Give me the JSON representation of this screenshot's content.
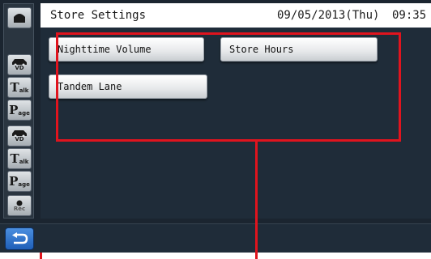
{
  "header": {
    "title": "Store Settings",
    "date": "09/05/2013(Thu)",
    "time": "09:35"
  },
  "sidebar": {
    "items": [
      {
        "icon": "car-vd-icon",
        "label": "VD"
      },
      {
        "icon": "talk-icon",
        "letter": "T",
        "label": "alk"
      },
      {
        "icon": "page-icon",
        "letter": "P",
        "label": "age"
      },
      {
        "icon": "car-vd-icon",
        "label": "VD"
      },
      {
        "icon": "talk-icon",
        "letter": "T",
        "label": "alk"
      },
      {
        "icon": "page-icon",
        "letter": "P",
        "label": "age"
      },
      {
        "icon": "record-icon",
        "label": "Rec"
      }
    ]
  },
  "menu": {
    "buttons": [
      {
        "label": "Nighttime Volume"
      },
      {
        "label": "Store Hours"
      },
      {
        "label": "Tandem Lane"
      }
    ]
  },
  "footer": {
    "back_icon": "back-arrow-icon"
  },
  "colors": {
    "background": "#1f2c39",
    "annotation": "#e0141e",
    "back_button": "#2f74cc"
  }
}
